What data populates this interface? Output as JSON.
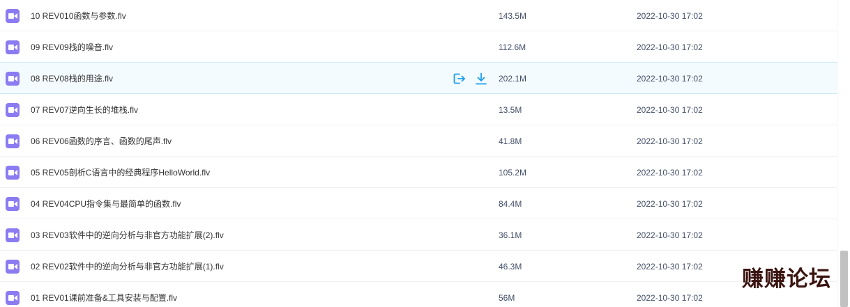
{
  "files": [
    {
      "name": "10 REV010函数与参数.flv",
      "size": "143.5M",
      "date": "2022-10-30 17:02",
      "icon": "video-file-icon"
    },
    {
      "name": "09 REV09栈的噪音.flv",
      "size": "112.6M",
      "date": "2022-10-30 17:02",
      "icon": "video-file-icon"
    },
    {
      "name": "08 REV08栈的用途.flv",
      "size": "202.1M",
      "date": "2022-10-30 17:02",
      "icon": "video-file-icon",
      "hovered": true
    },
    {
      "name": "07 REV07逆向生长的堆栈.flv",
      "size": "13.5M",
      "date": "2022-10-30 17:02",
      "icon": "video-file-icon"
    },
    {
      "name": "06 REV06函数的序言、函数的尾声.flv",
      "size": "41.8M",
      "date": "2022-10-30 17:02",
      "icon": "video-file-icon"
    },
    {
      "name": "05 REV05剖析C语言中的经典程序HelloWorld.flv",
      "size": "105.2M",
      "date": "2022-10-30 17:02",
      "icon": "video-file-icon"
    },
    {
      "name": "04 REV04CPU指令集与最简单的函数.flv",
      "size": "84.4M",
      "date": "2022-10-30 17:02",
      "icon": "video-file-icon"
    },
    {
      "name": "03 REV03软件中的逆向分析与非官方功能扩展(2).flv",
      "size": "36.1M",
      "date": "2022-10-30 17:02",
      "icon": "video-file-icon"
    },
    {
      "name": "02 REV02软件中的逆向分析与非官方功能扩展(1).flv",
      "size": "46.3M",
      "date": "2022-10-30 17:02",
      "icon": "video-file-icon"
    },
    {
      "name": "01 REV01课前准备&工具安装与配置.flv",
      "size": "56M",
      "date": "2022-10-30 17:02",
      "icon": "video-file-icon"
    }
  ],
  "row_actions": {
    "share_icon": "share-icon",
    "download_icon": "download-icon"
  },
  "watermark": {
    "text": "赚赚论坛"
  },
  "colors": {
    "file_icon": "#8b7cf2",
    "action_icon": "#1a9cf0",
    "hover_row": "#f4fbfe"
  }
}
